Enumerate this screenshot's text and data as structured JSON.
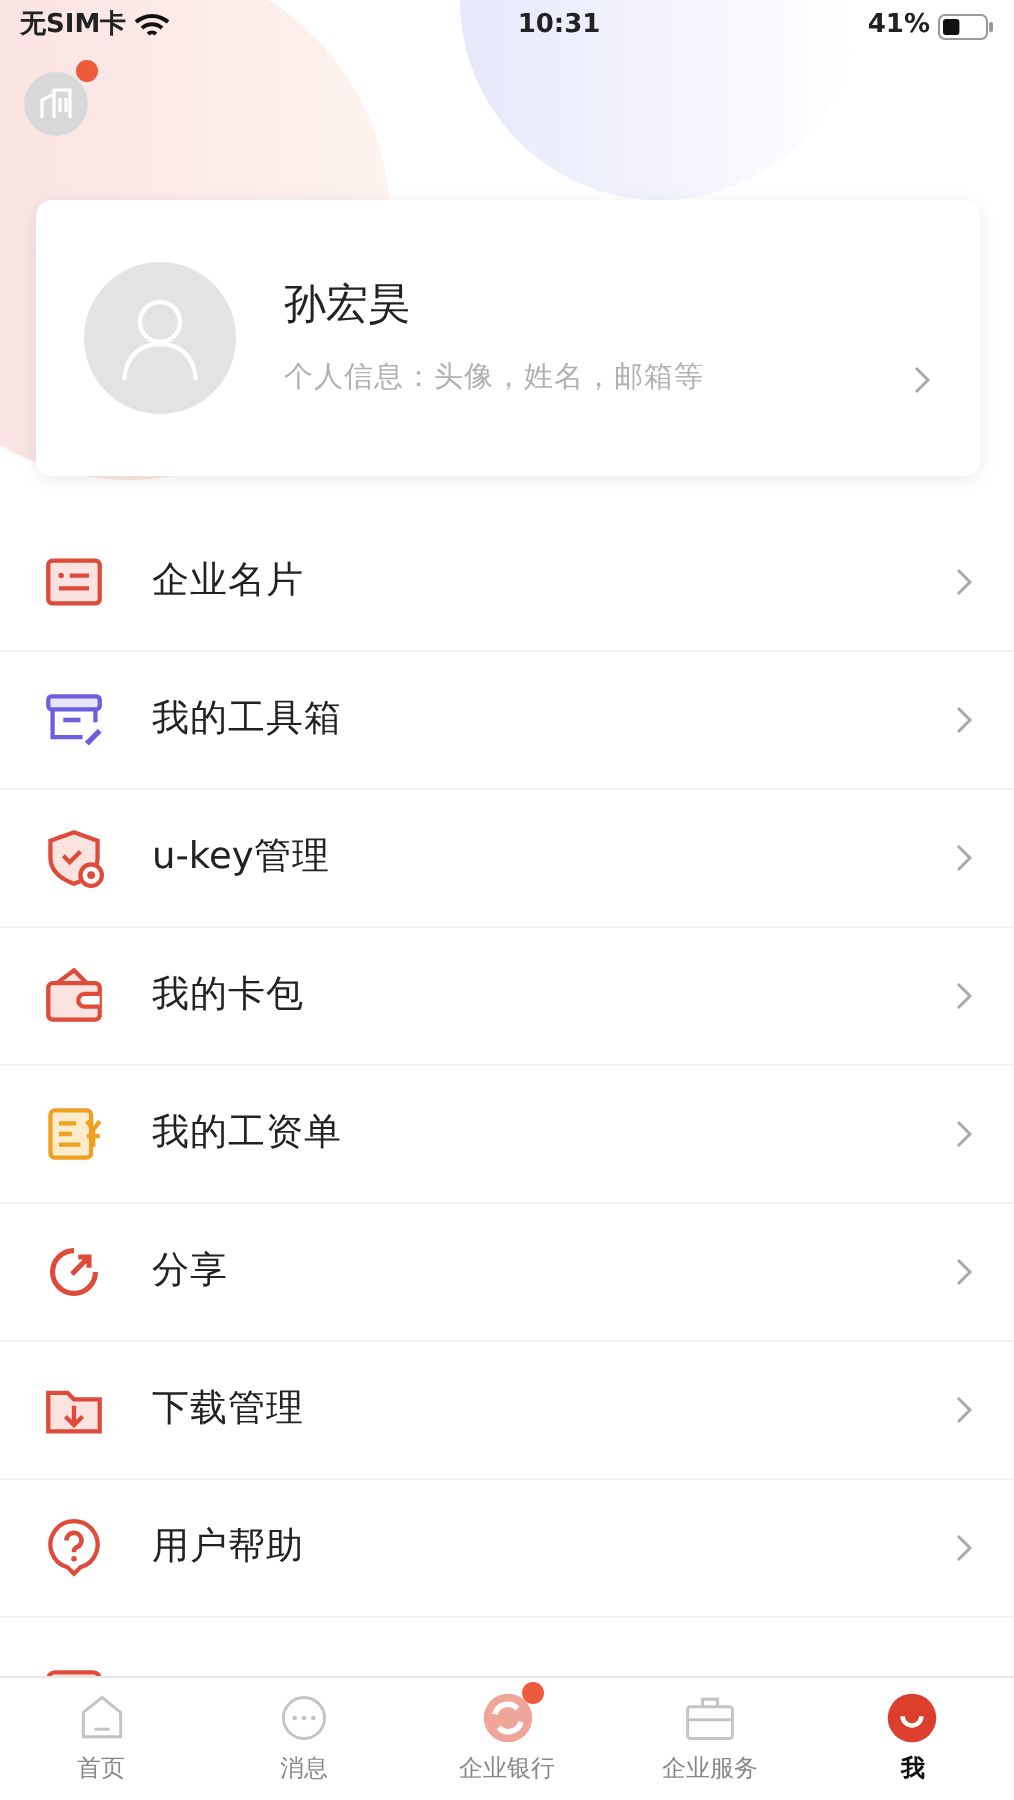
{
  "status_bar": {
    "carrier": "无SIM卡",
    "time": "10:31",
    "battery": "41%",
    "battery_icon": {
      "level": 0.41
    }
  },
  "header": {
    "notice_dot": true
  },
  "profile": {
    "name": "孙宏昊",
    "subtitle": "个人信息：头像，姓名，邮箱等"
  },
  "menu": [
    {
      "label": "企业名片"
    },
    {
      "label": "我的工具箱"
    },
    {
      "label": "u-key管理"
    },
    {
      "label": "我的卡包"
    },
    {
      "label": "我的工资单"
    },
    {
      "label": "分享"
    },
    {
      "label": "下载管理"
    },
    {
      "label": "用户帮助"
    }
  ],
  "tab_bar": [
    {
      "label": "首页",
      "selected": false,
      "dot": false
    },
    {
      "label": "消息",
      "selected": false,
      "dot": false
    },
    {
      "label": "企业银行",
      "selected": false,
      "dot": true
    },
    {
      "label": "企业服务",
      "selected": false,
      "dot": false
    },
    {
      "label": "我",
      "selected": true,
      "dot": false
    }
  ]
}
